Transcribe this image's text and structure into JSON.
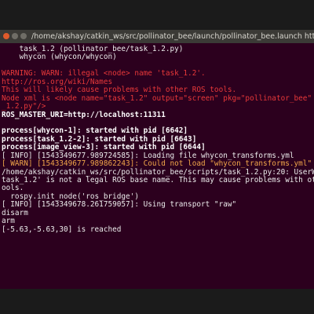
{
  "window": {
    "title": "/home/akshay/catkin_ws/src/pollinator_bee/launch/pollinator_bee.launch http://localhost"
  },
  "terminal": {
    "lines": [
      {
        "text": "    task_1.2 (pollinator_bee/task_1.2.py)",
        "style": "normal"
      },
      {
        "text": "    whycon (whycon/whycon)",
        "style": "normal"
      },
      {
        "text": "",
        "style": "normal"
      },
      {
        "text": "WARNING: WARN: illegal <node> name 'task_1.2'.",
        "style": "red"
      },
      {
        "text": "http://ros.org/wiki/Names",
        "style": "red"
      },
      {
        "text": "This will likely cause problems with other ROS tools.",
        "style": "red"
      },
      {
        "text": "Node xml is <node name=\"task_1.2\" output=\"screen\" pkg=\"pollinator_bee\" type=\"task",
        "style": "red"
      },
      {
        "text": "_1.2.py\"/>",
        "style": "red"
      },
      {
        "text": "ROS_MASTER_URI=http://localhost:11311",
        "style": "bold"
      },
      {
        "text": "",
        "style": "normal"
      },
      {
        "text": "process[whycon-1]: started with pid [6642]",
        "style": "bold"
      },
      {
        "text": "process[task_1.2-2]: started with pid [6643]",
        "style": "bold"
      },
      {
        "text": "process[image_view-3]: started with pid [6644]",
        "style": "bold"
      },
      {
        "text": "[ INFO] [1543349677.989724585]: Loading file whycon_transforms.yml",
        "style": "normal"
      },
      {
        "text": "[ WARN] [1543349677.989862243]: Could not load \"whycon_transforms.yml\"",
        "style": "orange"
      },
      {
        "text": "/home/akshay/catkin_ws/src/pollinator_bee/scripts/task_1.2.py:20: UserWarning: '",
        "style": "normal"
      },
      {
        "text": "task_1.2' is not a legal ROS base name. This may cause problems with other ROS t",
        "style": "normal"
      },
      {
        "text": "ools.",
        "style": "normal"
      },
      {
        "text": "  rospy.init_node('ros_bridge')",
        "style": "normal"
      },
      {
        "text": "[ INFO] [1543349678.261759057]: Using transport \"raw\"",
        "style": "normal"
      },
      {
        "text": "disarm",
        "style": "normal"
      },
      {
        "text": "arm",
        "style": "normal"
      },
      {
        "text": "[-5.63,-5.63,30] is reached",
        "style": "normal"
      }
    ]
  }
}
